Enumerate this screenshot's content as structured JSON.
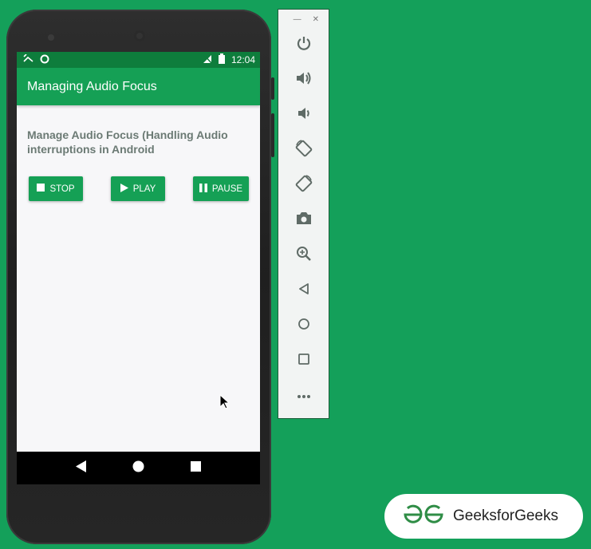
{
  "status_bar": {
    "time": "12:04"
  },
  "app": {
    "title": "Managing Audio Focus",
    "heading": "Manage Audio Focus (Handling Audio interruptions in Android",
    "buttons": {
      "stop": "STOP",
      "play": "PLAY",
      "pause": "PAUSE"
    }
  },
  "emulator_panel": {
    "tools": [
      "power-icon",
      "volume-up-icon",
      "volume-down-icon",
      "rotate-left-icon",
      "rotate-right-icon",
      "camera-icon",
      "zoom-icon",
      "back-icon",
      "home-icon",
      "overview-icon",
      "more-icon"
    ]
  },
  "watermark": {
    "text": "GeeksforGeeks"
  },
  "colors": {
    "background": "#14a05a",
    "app_bar": "#15a055",
    "status_bar": "#0e7d3c",
    "heading": "#6b7a74"
  }
}
